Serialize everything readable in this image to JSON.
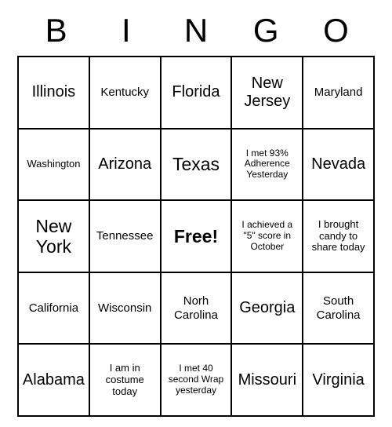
{
  "header": [
    "B",
    "I",
    "N",
    "G",
    "O"
  ],
  "grid": [
    [
      {
        "text": "Illinois",
        "size": "large"
      },
      {
        "text": "Kentucky",
        "size": ""
      },
      {
        "text": "Florida",
        "size": "large"
      },
      {
        "text": "New Jersey",
        "size": "large"
      },
      {
        "text": "Maryland",
        "size": ""
      }
    ],
    [
      {
        "text": "Washington",
        "size": "small"
      },
      {
        "text": "Arizona",
        "size": "large"
      },
      {
        "text": "Texas",
        "size": "xlarge"
      },
      {
        "text": "I met 93% Adherence Yesterday",
        "size": "xsmall"
      },
      {
        "text": "Nevada",
        "size": "large"
      }
    ],
    [
      {
        "text": "New York",
        "size": "xlarge"
      },
      {
        "text": "Tennessee",
        "size": ""
      },
      {
        "text": "Free!",
        "size": "",
        "free": true
      },
      {
        "text": "I achieved a \"5\" score in October",
        "size": "xsmall"
      },
      {
        "text": "I brought candy to share today",
        "size": "small"
      }
    ],
    [
      {
        "text": "California",
        "size": ""
      },
      {
        "text": "Wisconsin",
        "size": ""
      },
      {
        "text": "Norh Carolina",
        "size": ""
      },
      {
        "text": "Georgia",
        "size": "large"
      },
      {
        "text": "South Carolina",
        "size": ""
      }
    ],
    [
      {
        "text": "Alabama",
        "size": "large"
      },
      {
        "text": "I am in costume today",
        "size": "small"
      },
      {
        "text": "I met 40 second Wrap yesterday",
        "size": "xsmall"
      },
      {
        "text": "Missouri",
        "size": "large"
      },
      {
        "text": "Virginia",
        "size": "large"
      }
    ]
  ]
}
